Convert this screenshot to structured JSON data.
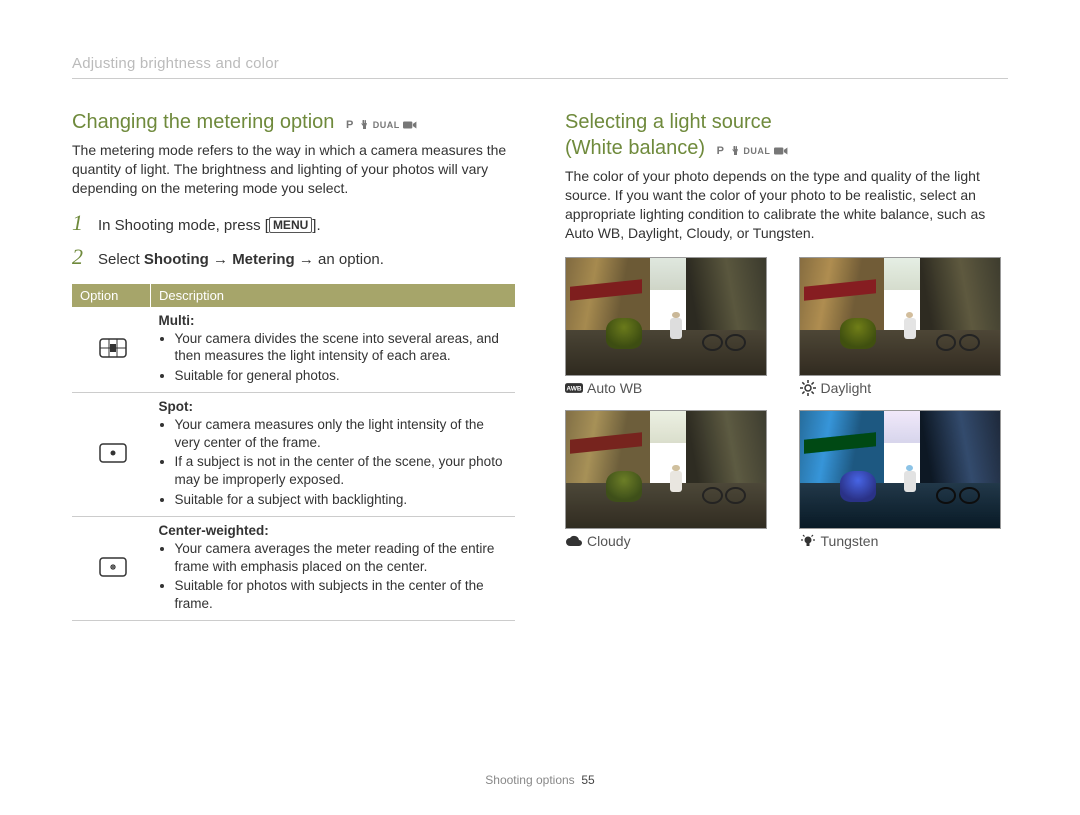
{
  "header": {
    "breadcrumb": "Adjusting brightness and color"
  },
  "left": {
    "title": "Changing the metering option",
    "modes": "P  DUAL",
    "intro": "The metering mode refers to the way in which a camera measures the quantity of light. The brightness and lighting of your photos will vary depending on the metering mode you select.",
    "steps": {
      "s1_pre": "In Shooting mode, press [",
      "s1_key": "MENU",
      "s1_post": "].",
      "s2_pre": "Select ",
      "s2_b1": "Shooting",
      "s2_arrow1": " → ",
      "s2_b2": "Metering",
      "s2_arrow2": " → an option."
    },
    "table": {
      "th_option": "Option",
      "th_desc": "Description",
      "rows": [
        {
          "name": "Multi",
          "icon": "metering-multi-icon",
          "bullets": [
            "Your camera divides the scene into several areas, and then measures the light intensity of each area.",
            "Suitable for general photos."
          ]
        },
        {
          "name": "Spot",
          "icon": "metering-spot-icon",
          "bullets": [
            "Your camera measures only the light intensity of the very center of the frame.",
            "If a subject is not in the center of the scene, your photo may be improperly exposed.",
            "Suitable for a subject with backlighting."
          ]
        },
        {
          "name": "Center-weighted",
          "icon": "metering-center-icon",
          "bullets": [
            "Your camera averages the meter reading of the entire frame with emphasis placed on the center.",
            "Suitable for photos with subjects in the center of the frame."
          ]
        }
      ]
    }
  },
  "right": {
    "title_line1": "Selecting a light source",
    "title_line2": "(White balance)",
    "modes": "P  DUAL",
    "intro": "The color of your photo depends on the type and quality of the light source. If you want the color of your photo to be realistic, select an appropriate lighting condition to calibrate the white balance, such as Auto WB, Daylight, Cloudy, or Tungsten.",
    "wb": [
      {
        "label": "Auto WB",
        "icon": "awb-icon",
        "tone": "normal"
      },
      {
        "label": "Daylight",
        "icon": "sun-icon",
        "tone": "daylight"
      },
      {
        "label": "Cloudy",
        "icon": "cloud-icon",
        "tone": "cloudy"
      },
      {
        "label": "Tungsten",
        "icon": "bulb-icon",
        "tone": "tungsten"
      }
    ]
  },
  "footer": {
    "section": "Shooting options",
    "page": "55"
  }
}
